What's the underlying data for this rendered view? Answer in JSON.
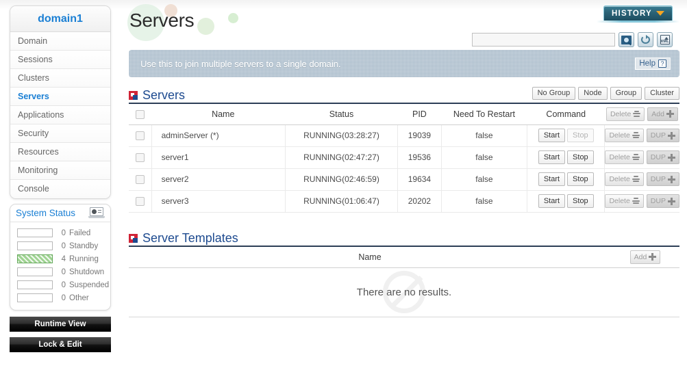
{
  "sidebar": {
    "domain_label": "domain1",
    "nav_items": [
      {
        "label": "Domain",
        "active": false
      },
      {
        "label": "Sessions",
        "active": false
      },
      {
        "label": "Clusters",
        "active": false
      },
      {
        "label": "Servers",
        "active": true
      },
      {
        "label": "Applications",
        "active": false
      },
      {
        "label": "Security",
        "active": false
      },
      {
        "label": "Resources",
        "active": false
      },
      {
        "label": "Monitoring",
        "active": false
      },
      {
        "label": "Console",
        "active": false
      }
    ],
    "system_status": {
      "title": "System Status",
      "icon": "laptop-chart-icon",
      "rows": [
        {
          "count": "0",
          "label": "Failed",
          "filled": false
        },
        {
          "count": "0",
          "label": "Standby",
          "filled": false
        },
        {
          "count": "4",
          "label": "Running",
          "filled": true
        },
        {
          "count": "0",
          "label": "Shutdown",
          "filled": false
        },
        {
          "count": "0",
          "label": "Suspended",
          "filled": false
        },
        {
          "count": "0",
          "label": "Other",
          "filled": false
        }
      ],
      "fill_color": "#9fd392"
    },
    "buttons": [
      {
        "label": "Runtime View"
      },
      {
        "label": "Lock & Edit"
      }
    ]
  },
  "header": {
    "page_title": "Servers",
    "history_button": {
      "label": "HISTORY",
      "icon": "chevron-down-icon",
      "accent": "#f5a623"
    },
    "search": {
      "value": "",
      "placeholder": ""
    },
    "toolbar_icons": [
      {
        "name": "search-icon"
      },
      {
        "name": "refresh-icon"
      },
      {
        "name": "xml-export-icon"
      }
    ]
  },
  "banner": {
    "text": "Use this to join multiple servers to a single domain.",
    "help_label": "Help",
    "help_icon": "question-mark-icon",
    "background": "#9fb3c4"
  },
  "servers_section": {
    "title": "Servers",
    "group_buttons": [
      "No Group",
      "Node",
      "Group",
      "Cluster"
    ],
    "header_actions": [
      {
        "label": "Delete",
        "icon": "stack-icon",
        "disabled": true
      },
      {
        "label": "Add",
        "icon": "plus-icon",
        "disabled": true
      }
    ],
    "columns": [
      "",
      "Name",
      "Status",
      "PID",
      "Need To Restart",
      "Command",
      ""
    ],
    "rows": [
      {
        "name": "adminServer (*)",
        "status": "RUNNING(03:28:27)",
        "pid": "19039",
        "need_to_restart": "false",
        "start_label": "Start",
        "stop_label": "Stop",
        "stop_disabled": true,
        "delete_label": "Delete",
        "dup_label": "DUP"
      },
      {
        "name": "server1",
        "status": "RUNNING(02:47:27)",
        "pid": "19536",
        "need_to_restart": "false",
        "start_label": "Start",
        "stop_label": "Stop",
        "stop_disabled": false,
        "delete_label": "Delete",
        "dup_label": "DUP"
      },
      {
        "name": "server2",
        "status": "RUNNING(02:46:59)",
        "pid": "19634",
        "need_to_restart": "false",
        "start_label": "Start",
        "stop_label": "Stop",
        "stop_disabled": false,
        "delete_label": "Delete",
        "dup_label": "DUP"
      },
      {
        "name": "server3",
        "status": "RUNNING(01:06:47)",
        "pid": "20202",
        "need_to_restart": "false",
        "start_label": "Start",
        "stop_label": "Stop",
        "stop_disabled": false,
        "delete_label": "Delete",
        "dup_label": "DUP"
      }
    ]
  },
  "templates_section": {
    "title": "Server Templates",
    "column_name": "Name",
    "add_label": "Add",
    "add_icon": "plus-icon",
    "empty_text": "There are no results."
  }
}
